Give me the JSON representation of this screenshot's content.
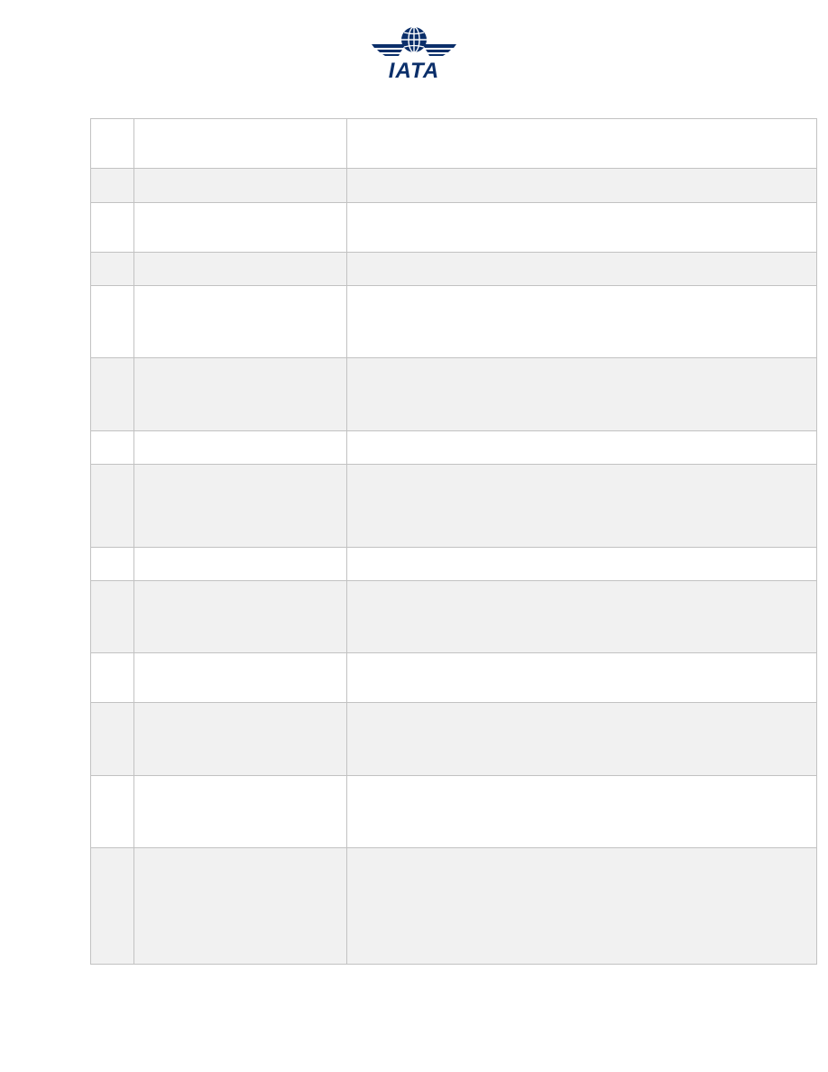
{
  "logo": {
    "text": "IATA",
    "icon": "globe-wings-icon",
    "color": "#0b2f6a"
  },
  "table": {
    "border_color": "#c2c2c2",
    "shaded_color": "#f1f1f1",
    "rows": [
      {
        "shaded": false
      },
      {
        "shaded": true
      },
      {
        "shaded": false
      },
      {
        "shaded": true
      },
      {
        "shaded": false
      },
      {
        "shaded": true
      },
      {
        "shaded": false
      },
      {
        "shaded": true
      },
      {
        "shaded": false
      },
      {
        "shaded": true
      },
      {
        "shaded": false
      },
      {
        "shaded": true
      },
      {
        "shaded": false
      },
      {
        "shaded": true
      }
    ]
  }
}
